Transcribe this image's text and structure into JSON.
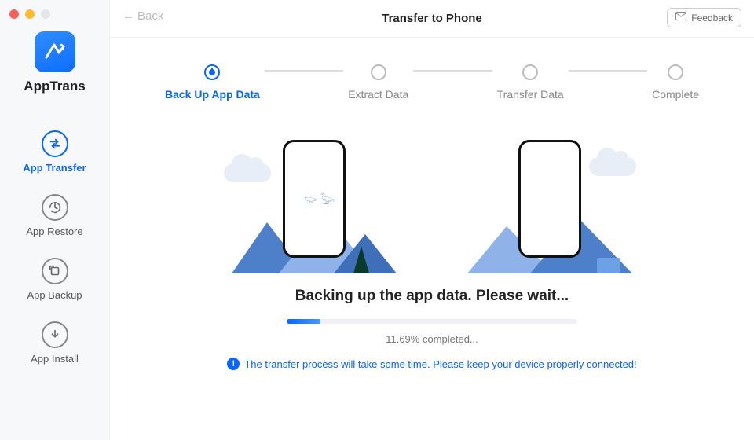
{
  "brand": {
    "name": "AppTrans"
  },
  "sidebar": {
    "items": [
      {
        "label": "App Transfer"
      },
      {
        "label": "App Restore"
      },
      {
        "label": "App Backup"
      },
      {
        "label": "App Install"
      }
    ]
  },
  "header": {
    "back": "Back",
    "title": "Transfer to Phone",
    "feedback": "Feedback"
  },
  "stepper": {
    "steps": [
      {
        "label": "Back Up App Data"
      },
      {
        "label": "Extract Data"
      },
      {
        "label": "Transfer Data"
      },
      {
        "label": "Complete"
      }
    ]
  },
  "status": {
    "title": "Backing up the app data. Please wait...",
    "percent_text": "11.69% completed...",
    "note": "The transfer process will take some time. Please keep your device properly connected!"
  },
  "progress": {
    "percent": 11.69
  },
  "colors": {
    "accent": "#0b64ff"
  }
}
